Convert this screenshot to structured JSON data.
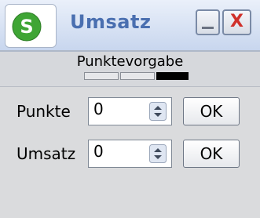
{
  "window": {
    "title": "Umsatz",
    "app_icon_glyph": "S",
    "close_glyph": "X"
  },
  "header": {
    "title": "Punktevorgabe",
    "indicator_active_index": 3,
    "indicator_count": 3
  },
  "form": {
    "rows": [
      {
        "label": "Punkte",
        "value": "0",
        "button": "OK"
      },
      {
        "label": "Umsatz",
        "value": "0",
        "button": "OK"
      }
    ]
  },
  "colors": {
    "title_text": "#4a6fb0",
    "app_icon": "#3fa535",
    "close_x": "#d0302a"
  },
  "icons": [
    "app-icon",
    "minimize-icon",
    "close-icon",
    "spin-up-icon",
    "spin-down-icon"
  ]
}
